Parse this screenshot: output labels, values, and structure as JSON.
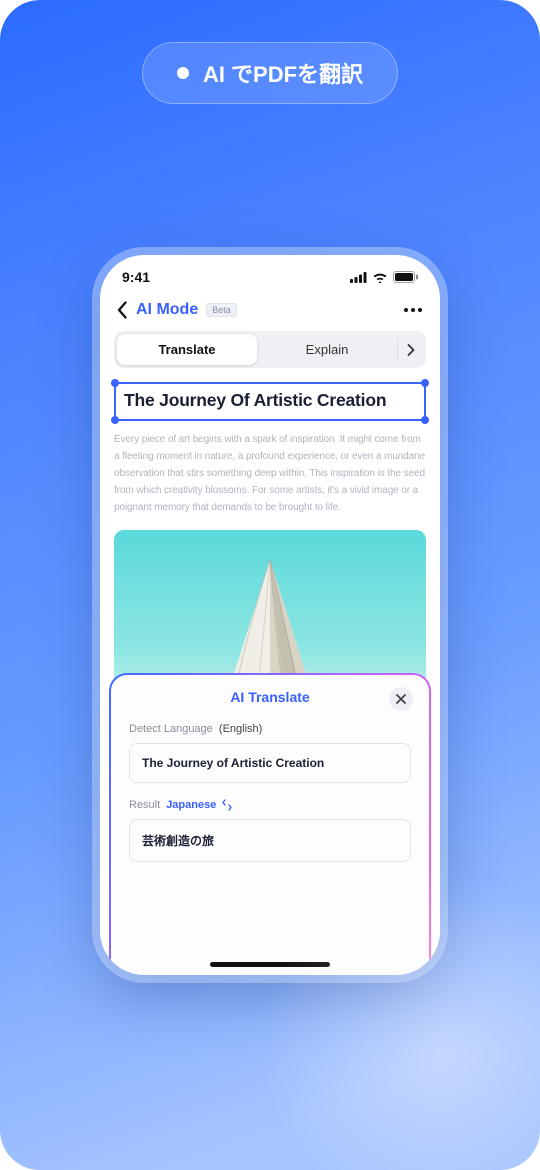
{
  "pill": {
    "label": "AI でPDFを翻訳"
  },
  "status": {
    "time": "9:41"
  },
  "nav": {
    "title": "AI Mode",
    "badge": "Beta"
  },
  "tabs": {
    "translate": "Translate",
    "explain": "Explain"
  },
  "article": {
    "title": "The Journey Of Artistic Creation",
    "body": "Every piece of art begins with a spark of inspiration. It might come from a fleeting moment in nature, a profound experience, or even a mundane observation that stirs something deep within. This inspiration is the seed from which creativity blossoms. For some artists, it's a vivid image or a poignant memory that demands to be brought to life."
  },
  "translate_card": {
    "title": "AI Translate",
    "detect_label": "Detect Language",
    "detected": "(English)",
    "source_text": "The Journey of Artistic Creation",
    "result_label": "Result",
    "target_lang": "Japanese",
    "translated_text": "芸術創造の旅"
  }
}
